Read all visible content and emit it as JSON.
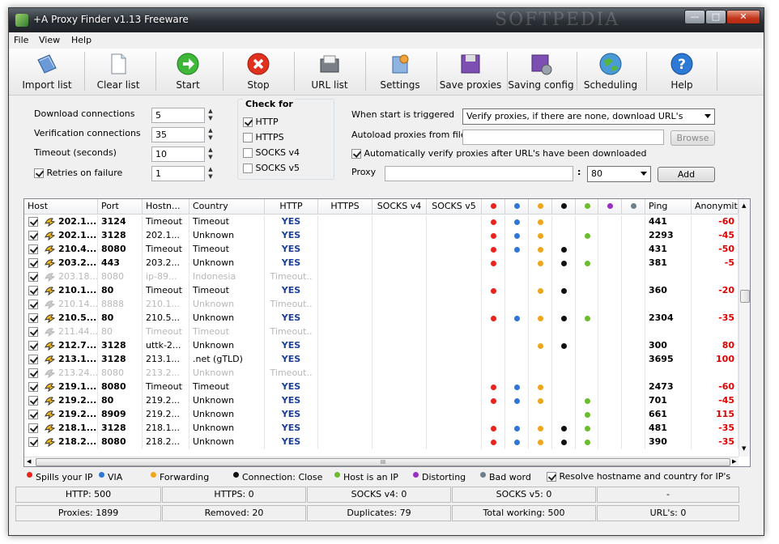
{
  "window": {
    "title": "+A Proxy Finder v1.13 Freeware",
    "watermark": "SOFTPEDIA"
  },
  "menu": [
    "File",
    "View",
    "Help"
  ],
  "toolbar": [
    {
      "label": "Import list",
      "icon": "import-icon"
    },
    {
      "label": "Clear list",
      "icon": "document-icon"
    },
    {
      "label": "Start",
      "icon": "start-icon"
    },
    {
      "label": "Stop",
      "icon": "stop-icon"
    },
    {
      "label": "URL list",
      "icon": "url-list-icon"
    },
    {
      "label": "Settings",
      "icon": "settings-icon"
    },
    {
      "label": "Save proxies",
      "icon": "save-icon"
    },
    {
      "label": "Saving config",
      "icon": "saving-config-icon"
    },
    {
      "label": "Scheduling",
      "icon": "globe-icon"
    },
    {
      "label": "Help",
      "icon": "help-icon"
    }
  ],
  "settings": {
    "download_connections_label": "Download connections",
    "download_connections": "5",
    "verification_connections_label": "Verification connections",
    "verification_connections": "35",
    "timeout_label": "Timeout (seconds)",
    "timeout": "10",
    "retries_label": "Retries on failure",
    "retries": "1",
    "retries_checked": true
  },
  "check_for": {
    "title": "Check for",
    "items": [
      {
        "label": "HTTP",
        "checked": true
      },
      {
        "label": "HTTPS",
        "checked": false
      },
      {
        "label": "SOCKS v4",
        "checked": false
      },
      {
        "label": "SOCKS v5",
        "checked": false
      }
    ]
  },
  "start": {
    "when_start_label": "When start is triggered",
    "when_start_value": "Verify proxies, if there are none, download URL's",
    "autoload_label": "Autoload proxies from file",
    "browse_label": "Browse",
    "auto_verify_label": "Automatically verify proxies after URL's have been downloaded",
    "auto_verify_checked": true,
    "proxy_label": "Proxy",
    "proxy_sep": ":",
    "port_value": "80",
    "add_label": "Add"
  },
  "colors": {
    "red": "#e8241c",
    "blue": "#2f77d6",
    "orange": "#f0a51c",
    "black": "#111111",
    "green": "#6cbb2c",
    "purple": "#9b2fc4",
    "gray": "#6e7f8c",
    "http_yes": "#1c3f9c",
    "anonymity": "#e00000"
  },
  "table": {
    "columns": [
      "Host",
      "Port",
      "Hostn...",
      "Country",
      "HTTP",
      "HTTPS",
      "SOCKS v4",
      "SOCKS v5",
      "",
      "",
      "",
      "",
      "",
      "",
      "",
      "Ping",
      "Anonymit"
    ],
    "dot_columns": [
      "red",
      "blue",
      "orange",
      "black",
      "green",
      "purple",
      "gray"
    ],
    "rows": [
      {
        "host": "202.1...",
        "port": "3124",
        "hostname": "Timeout",
        "country": "Timeout",
        "http": "YES",
        "dots": [
          "red",
          "blue",
          "orange"
        ],
        "ping": "441",
        "anon": "-60",
        "active": true
      },
      {
        "host": "202.1...",
        "port": "3128",
        "hostname": "202.1...",
        "country": "Unknown",
        "http": "YES",
        "dots": [
          "red",
          "blue",
          "orange",
          "green"
        ],
        "ping": "2293",
        "anon": "-45",
        "active": true
      },
      {
        "host": "210.4...",
        "port": "8080",
        "hostname": "Timeout",
        "country": "Timeout",
        "http": "YES",
        "dots": [
          "red",
          "blue",
          "orange",
          "black"
        ],
        "ping": "431",
        "anon": "-50",
        "active": true
      },
      {
        "host": "203.2...",
        "port": "443",
        "hostname": "203.2...",
        "country": "Unknown",
        "http": "YES",
        "dots": [
          "red",
          "orange",
          "black",
          "green"
        ],
        "ping": "381",
        "anon": "-5",
        "active": true
      },
      {
        "host": "203.18...",
        "port": "8080",
        "hostname": "ip-89...",
        "country": "Indonesia",
        "http": "Timeout..",
        "dots": [],
        "ping": "",
        "anon": "",
        "active": false
      },
      {
        "host": "210.1...",
        "port": "80",
        "hostname": "Timeout",
        "country": "Timeout",
        "http": "YES",
        "dots": [
          "red",
          "orange",
          "black"
        ],
        "ping": "360",
        "anon": "-20",
        "active": true
      },
      {
        "host": "210.14...",
        "port": "8888",
        "hostname": "210.1...",
        "country": "Unknown",
        "http": "Timeout..",
        "dots": [],
        "ping": "",
        "anon": "",
        "active": false
      },
      {
        "host": "210.5...",
        "port": "80",
        "hostname": "210.5...",
        "country": "Unknown",
        "http": "YES",
        "dots": [
          "red",
          "blue",
          "orange",
          "black",
          "green"
        ],
        "ping": "2304",
        "anon": "-35",
        "active": true
      },
      {
        "host": "211.44...",
        "port": "80",
        "hostname": "Timeout",
        "country": "Timeout",
        "http": "Timeout..",
        "dots": [],
        "ping": "",
        "anon": "",
        "active": false
      },
      {
        "host": "212.7...",
        "port": "3128",
        "hostname": "uttk-2...",
        "country": "Unknown",
        "http": "YES",
        "dots": [
          "orange",
          "black"
        ],
        "ping": "300",
        "anon": "80",
        "active": true
      },
      {
        "host": "213.1...",
        "port": "3128",
        "hostname": "213.1...",
        "country": ".net (gTLD)",
        "http": "YES",
        "dots": [],
        "ping": "3695",
        "anon": "100",
        "active": true
      },
      {
        "host": "213.24...",
        "port": "8080",
        "hostname": "213.2...",
        "country": "Unknown",
        "http": "Timeout..",
        "dots": [],
        "ping": "",
        "anon": "",
        "active": false
      },
      {
        "host": "219.1...",
        "port": "8080",
        "hostname": "Timeout",
        "country": "Timeout",
        "http": "YES",
        "dots": [
          "red",
          "blue",
          "orange"
        ],
        "ping": "2473",
        "anon": "-60",
        "active": true
      },
      {
        "host": "219.2...",
        "port": "80",
        "hostname": "219.2...",
        "country": "Unknown",
        "http": "YES",
        "dots": [
          "red",
          "blue",
          "orange",
          "green"
        ],
        "ping": "701",
        "anon": "-45",
        "active": true
      },
      {
        "host": "219.2...",
        "port": "8909",
        "hostname": "219.2...",
        "country": "Unknown",
        "http": "YES",
        "dots": [
          "green"
        ],
        "ping": "661",
        "anon": "115",
        "active": true
      },
      {
        "host": "218.1...",
        "port": "3128",
        "hostname": "218.1...",
        "country": "Unknown",
        "http": "YES",
        "dots": [
          "red",
          "blue",
          "orange",
          "black",
          "green"
        ],
        "ping": "481",
        "anon": "-35",
        "active": true
      },
      {
        "host": "218.2...",
        "port": "8080",
        "hostname": "218.2...",
        "country": "Unknown",
        "http": "YES",
        "dots": [
          "red",
          "blue",
          "orange",
          "black",
          "green"
        ],
        "ping": "390",
        "anon": "-35",
        "active": true
      }
    ],
    "hscroll_grip": "III"
  },
  "legend": [
    {
      "label": "Spills your IP",
      "color": "red"
    },
    {
      "label": "VIA",
      "color": "blue"
    },
    {
      "label": "Forwarding",
      "color": "orange"
    },
    {
      "label": "Connection: Close",
      "color": "black"
    },
    {
      "label": "Host is an IP",
      "color": "green"
    },
    {
      "label": "Distorting",
      "color": "purple"
    },
    {
      "label": "Bad word",
      "color": "gray"
    }
  ],
  "resolve_label": "Resolve hostname and country for IP's",
  "resolve_checked": true,
  "status_row1": [
    "HTTP: 500",
    "HTTPS: 0",
    "SOCKS v4: 0",
    "SOCKS v5: 0",
    "-"
  ],
  "status_row2": [
    "Proxies: 1899",
    "Removed: 20",
    "Duplicates: 79",
    "Total working: 500",
    "URL's: 0"
  ]
}
